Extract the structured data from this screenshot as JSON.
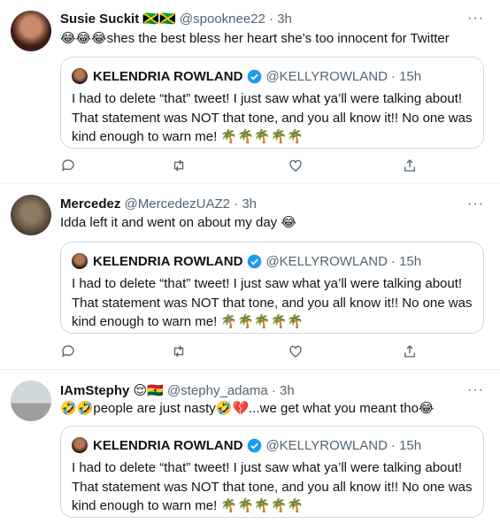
{
  "tweets": [
    {
      "name": "Susie Suckit",
      "name_emoji": "🇯🇲🇯🇲",
      "handle": "@spooknee22",
      "time": "· 3h",
      "more": "···",
      "text": "😂😂😂shes the best bless her heart she’s too innocent for Twitter"
    },
    {
      "name": "Mercedez",
      "handle": "@MercedezUAZ2",
      "time": "· 3h",
      "more": "···",
      "text": "Idda left it and went on about my day 😂"
    },
    {
      "name": "IAmStephy",
      "name_emoji": "😌🇬🇭",
      "handle": "@stephy_adama",
      "time": "· 3h",
      "more": "···",
      "text": "🤣🤣people are just nasty🤣💔...we get what you meant tho😂"
    }
  ],
  "quote": {
    "name": "KELENDRIA ROWLAND",
    "handle": "@KELLYROWLAND",
    "time": "· 15h",
    "text": "I had to delete “that” tweet! I just saw what ya’ll were talking about! That statement was NOT that tone, and you all know it!! No one was kind enough to warn me! 🌴🌴🌴🌴🌴"
  },
  "icons": [
    "reply-icon",
    "retweet-icon",
    "like-icon",
    "share-icon"
  ],
  "colors": {
    "secondary_text": "#536471",
    "border": "#cfd9de",
    "verified": "#1d9bf0"
  }
}
